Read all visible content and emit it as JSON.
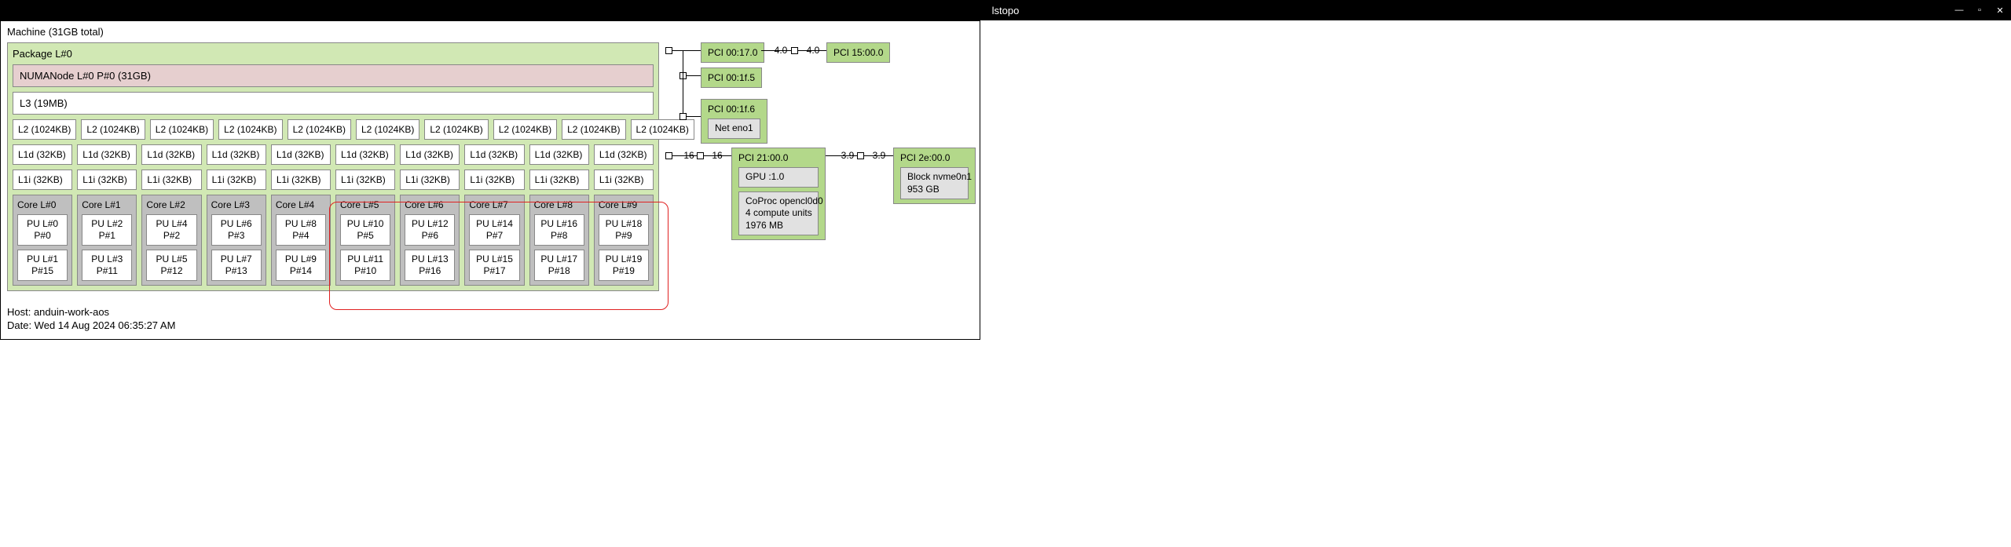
{
  "window": {
    "title": "lstopo"
  },
  "machine": {
    "label": "Machine (31GB total)"
  },
  "package": {
    "label": "Package L#0"
  },
  "numa": {
    "label": "NUMANode L#0 P#0 (31GB)"
  },
  "l3": {
    "label": "L3 (19MB)"
  },
  "l2": [
    "L2 (1024KB)",
    "L2 (1024KB)",
    "L2 (1024KB)",
    "L2 (1024KB)",
    "L2 (1024KB)",
    "L2 (1024KB)",
    "L2 (1024KB)",
    "L2 (1024KB)",
    "L2 (1024KB)",
    "L2 (1024KB)"
  ],
  "l1d": [
    "L1d (32KB)",
    "L1d (32KB)",
    "L1d (32KB)",
    "L1d (32KB)",
    "L1d (32KB)",
    "L1d (32KB)",
    "L1d (32KB)",
    "L1d (32KB)",
    "L1d (32KB)",
    "L1d (32KB)"
  ],
  "l1i": [
    "L1i (32KB)",
    "L1i (32KB)",
    "L1i (32KB)",
    "L1i (32KB)",
    "L1i (32KB)",
    "L1i (32KB)",
    "L1i (32KB)",
    "L1i (32KB)",
    "L1i (32KB)",
    "L1i (32KB)"
  ],
  "cores": [
    {
      "label": "Core L#0",
      "pu": [
        {
          "l": "PU L#0",
          "p": "P#0"
        },
        {
          "l": "PU L#1",
          "p": "P#15"
        }
      ]
    },
    {
      "label": "Core L#1",
      "pu": [
        {
          "l": "PU L#2",
          "p": "P#1"
        },
        {
          "l": "PU L#3",
          "p": "P#11"
        }
      ]
    },
    {
      "label": "Core L#2",
      "pu": [
        {
          "l": "PU L#4",
          "p": "P#2"
        },
        {
          "l": "PU L#5",
          "p": "P#12"
        }
      ]
    },
    {
      "label": "Core L#3",
      "pu": [
        {
          "l": "PU L#6",
          "p": "P#3"
        },
        {
          "l": "PU L#7",
          "p": "P#13"
        }
      ]
    },
    {
      "label": "Core L#4",
      "pu": [
        {
          "l": "PU L#8",
          "p": "P#4"
        },
        {
          "l": "PU L#9",
          "p": "P#14"
        }
      ]
    },
    {
      "label": "Core L#5",
      "pu": [
        {
          "l": "PU L#10",
          "p": "P#5"
        },
        {
          "l": "PU L#11",
          "p": "P#10"
        }
      ]
    },
    {
      "label": "Core L#6",
      "pu": [
        {
          "l": "PU L#12",
          "p": "P#6"
        },
        {
          "l": "PU L#13",
          "p": "P#16"
        }
      ]
    },
    {
      "label": "Core L#7",
      "pu": [
        {
          "l": "PU L#14",
          "p": "P#7"
        },
        {
          "l": "PU L#15",
          "p": "P#17"
        }
      ]
    },
    {
      "label": "Core L#8",
      "pu": [
        {
          "l": "PU L#16",
          "p": "P#8"
        },
        {
          "l": "PU L#17",
          "p": "P#18"
        }
      ]
    },
    {
      "label": "Core L#9",
      "pu": [
        {
          "l": "PU L#18",
          "p": "P#9"
        },
        {
          "l": "PU L#19",
          "p": "P#19"
        }
      ]
    }
  ],
  "pci": {
    "p0": "PCI 00:17.0",
    "p1": "PCI 15:00.0",
    "bw01a": "4.0",
    "bw01b": "4.0",
    "p2": "PCI 00:1f.5",
    "p3": "PCI 00:1f.6",
    "p3_net": "Net eno1",
    "p4": "PCI 21:00.0",
    "p4_gpu": "GPU :1.0",
    "p4_coproc_l1": "CoProc opencl0d0",
    "p4_coproc_l2": "4 compute units",
    "p4_coproc_l3": "1976 MB",
    "bw4a": "16",
    "bw4b": "16",
    "p5": "PCI 2e:00.0",
    "p5_blk_l1": "Block nvme0n1",
    "p5_blk_l2": "953 GB",
    "bw5a": "3.9",
    "bw5b": "3.9"
  },
  "footer": {
    "host": "Host: anduin-work-aos",
    "date": "Date: Wed 14 Aug 2024 06:35:27 AM"
  }
}
